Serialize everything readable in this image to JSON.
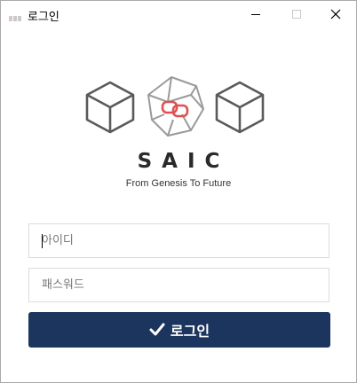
{
  "window": {
    "title": "로그인",
    "icon": "app-icon"
  },
  "window_controls": {
    "minimize_icon": "minimize-icon",
    "maximize_icon": "maximize-icon",
    "close_icon": "close-icon"
  },
  "brand": {
    "name": "SAIC",
    "tagline": "From Genesis To Future",
    "logo_icons": [
      "cube-icon",
      "link-polyhedron-icon",
      "cube-icon"
    ],
    "colors": {
      "cube": "#5a5a5a",
      "polyhedron": "#9a9a9a",
      "link": "#e05050"
    }
  },
  "form": {
    "id_field": {
      "placeholder": "아이디",
      "value": ""
    },
    "password_field": {
      "placeholder": "패스워드",
      "value": ""
    },
    "login_button": {
      "label": "로그인",
      "icon": "check-icon",
      "color": "#1c355e"
    }
  }
}
